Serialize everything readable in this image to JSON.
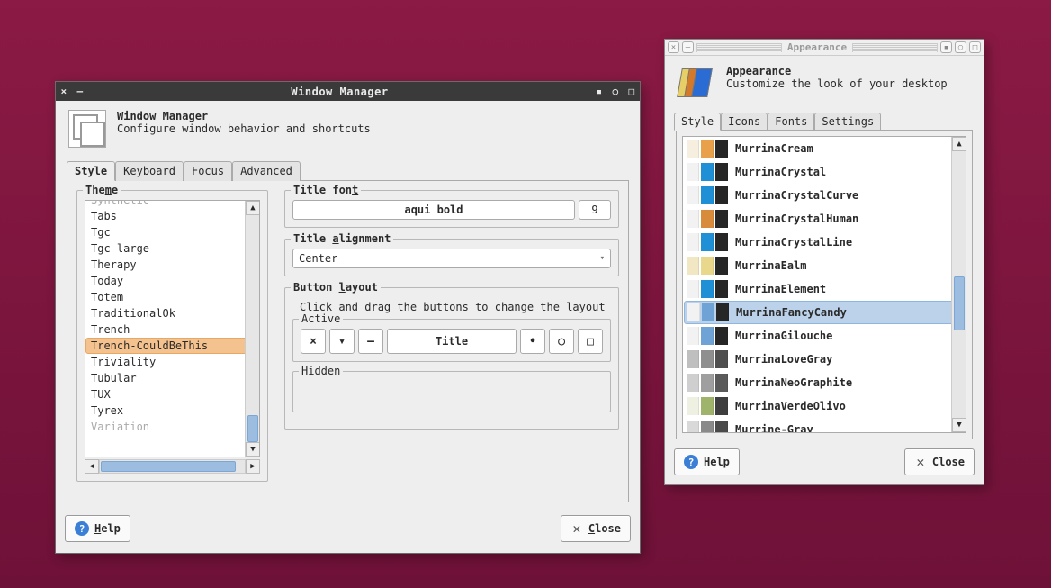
{
  "wm": {
    "titlebar": "Window Manager",
    "header_title": "Window Manager",
    "header_sub": "Configure window behavior and shortcuts",
    "tabs": {
      "style": "Style",
      "keyboard": "Keyboard",
      "focus": "Focus",
      "advanced": "Advanced"
    },
    "theme_label": "Theme",
    "themes": [
      "Synthetic",
      "Tabs",
      "Tgc",
      "Tgc-large",
      "Therapy",
      "Today",
      "Totem",
      "TraditionalOk",
      "Trench",
      "Trench-CouldBeThis",
      "Triviality",
      "Tubular",
      "TUX",
      "Tyrex",
      "Variation"
    ],
    "theme_selected": "Trench-CouldBeThis",
    "title_font_label": "Title font",
    "title_font_name": "aqui bold",
    "title_font_size": "9",
    "title_align_label": "Title alignment",
    "title_align_value": "Center",
    "button_layout_label": "Button layout",
    "button_layout_help": "Click and drag the buttons to change the layout",
    "active_label": "Active",
    "hidden_label": "Hidden",
    "title_button": "Title",
    "help_btn": "Help",
    "close_btn": "Close"
  },
  "ap": {
    "titlebar": "Appearance",
    "header_title": "Appearance",
    "header_sub": "Customize the look of your desktop",
    "tabs": {
      "style": "Style",
      "icons": "Icons",
      "fonts": "Fonts",
      "settings": "Settings"
    },
    "styles": [
      {
        "name": "MurrinaCream",
        "c": [
          "#f6efe0",
          "#e9a04b",
          "#262626"
        ]
      },
      {
        "name": "MurrinaCrystal",
        "c": [
          "#f2f2f2",
          "#1f8fd6",
          "#262626"
        ]
      },
      {
        "name": "MurrinaCrystalCurve",
        "c": [
          "#f2f2f2",
          "#1f8fd6",
          "#262626"
        ]
      },
      {
        "name": "MurrinaCrystalHuman",
        "c": [
          "#f2f2f2",
          "#d88b3a",
          "#262626"
        ]
      },
      {
        "name": "MurrinaCrystalLine",
        "c": [
          "#f2f2f2",
          "#1f8fd6",
          "#262626"
        ]
      },
      {
        "name": "MurrinaEalm",
        "c": [
          "#f1e7c3",
          "#e9d78b",
          "#262626"
        ]
      },
      {
        "name": "MurrinaElement",
        "c": [
          "#f2f2f2",
          "#1f8fd6",
          "#262626"
        ]
      },
      {
        "name": "MurrinaFancyCandy",
        "c": [
          "#f2f2f2",
          "#6fa3d6",
          "#262626"
        ]
      },
      {
        "name": "MurrinaGilouche",
        "c": [
          "#f2f2f2",
          "#6fa3d6",
          "#262626"
        ]
      },
      {
        "name": "MurrinaLoveGray",
        "c": [
          "#bfbfbf",
          "#8f8f8f",
          "#4f4f4f"
        ]
      },
      {
        "name": "MurrinaNeoGraphite",
        "c": [
          "#cfcfcf",
          "#9f9f9f",
          "#5a5a5a"
        ]
      },
      {
        "name": "MurrinaVerdeOlivo",
        "c": [
          "#eef0e2",
          "#9fb36a",
          "#3e3e3e"
        ]
      },
      {
        "name": "Murrine-Gray",
        "c": [
          "#d9d9d9",
          "#8a8a8a",
          "#4a4a4a"
        ]
      }
    ],
    "style_selected": "MurrinaFancyCandy",
    "help_btn": "Help",
    "close_btn": "Close"
  }
}
